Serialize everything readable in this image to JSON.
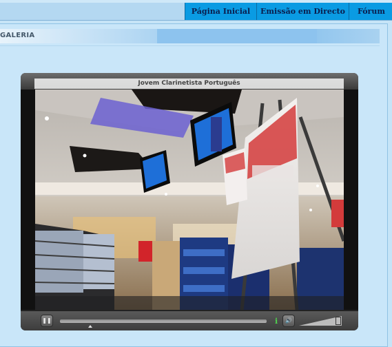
{
  "nav": {
    "items": [
      {
        "label": "Página Inicial"
      },
      {
        "label": "Emissão em Directo"
      },
      {
        "label": "Fórum"
      }
    ]
  },
  "section": {
    "title": "GALERIA"
  },
  "player": {
    "title": "Jovem Clarinetista Português",
    "info_symbol": "i",
    "seek_progress": 0.14,
    "volume_level": 0.85
  },
  "colors": {
    "nav_bg": "#0a9be3",
    "page_bg": "#c6e4f7",
    "section_bar": "#8dc3ee"
  },
  "icons": [
    "pause-icon",
    "speaker-icon",
    "info-icon"
  ]
}
